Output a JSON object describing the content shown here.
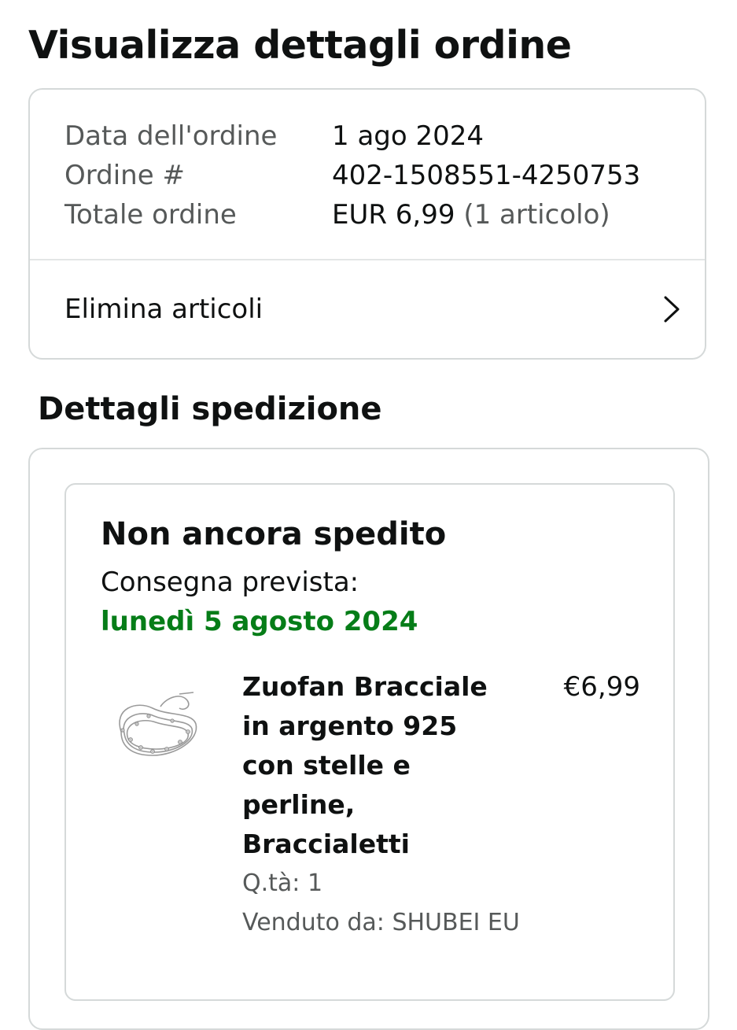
{
  "page": {
    "title": "Visualizza dettagli ordine"
  },
  "summary": {
    "rows": [
      {
        "label": "Data dell'ordine",
        "value": "1 ago 2024"
      },
      {
        "label": "Ordine #",
        "value": "402-1508551-4250753"
      },
      {
        "label": "Totale ordine",
        "value": "EUR 6,99",
        "extra": "(1 articolo)"
      }
    ],
    "elimina_label": "Elimina articoli",
    "elimina_icon": "chevron-right-icon"
  },
  "shipping": {
    "section_title": "Dettagli spedizione",
    "status": "Non ancora spedito",
    "delivery_label": "Consegna prevista:",
    "delivery_date": "lunedì 5 agosto 2024",
    "delivery_color": "#067d18",
    "item": {
      "image_icon": "bracelet-image",
      "title": "Zuofan Bracciale in argento 925 con stelle e perline, Braccialetti",
      "price": "€6,99",
      "quantity": "Q.tà: 1",
      "seller": "Venduto da: SHUBEI EU"
    }
  }
}
